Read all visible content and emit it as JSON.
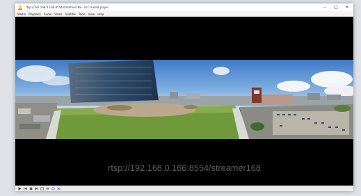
{
  "window": {
    "title": "rtsp://192.168.0.166:8554/streamer168 - VLC media player",
    "controls": [
      "–",
      "□",
      "✕"
    ]
  },
  "menu": [
    "Media",
    "Playback",
    "Audio",
    "Video",
    "Subtitle",
    "Tools",
    "View",
    "Help"
  ],
  "video": {
    "caption": "rtsp://192.168.0.166:8554/streamer168"
  },
  "icons": {
    "app": "vlc-cone-icon",
    "playback": [
      "play-icon",
      "prev-icon",
      "stop-icon",
      "next-icon",
      "fullscreen-icon",
      "playlist-icon",
      "loop-icon",
      "shuffle-icon"
    ]
  },
  "colors": {
    "vlc_orange": "#f08a00",
    "video_bg": "#000000",
    "caption": "#5e5e5e"
  }
}
